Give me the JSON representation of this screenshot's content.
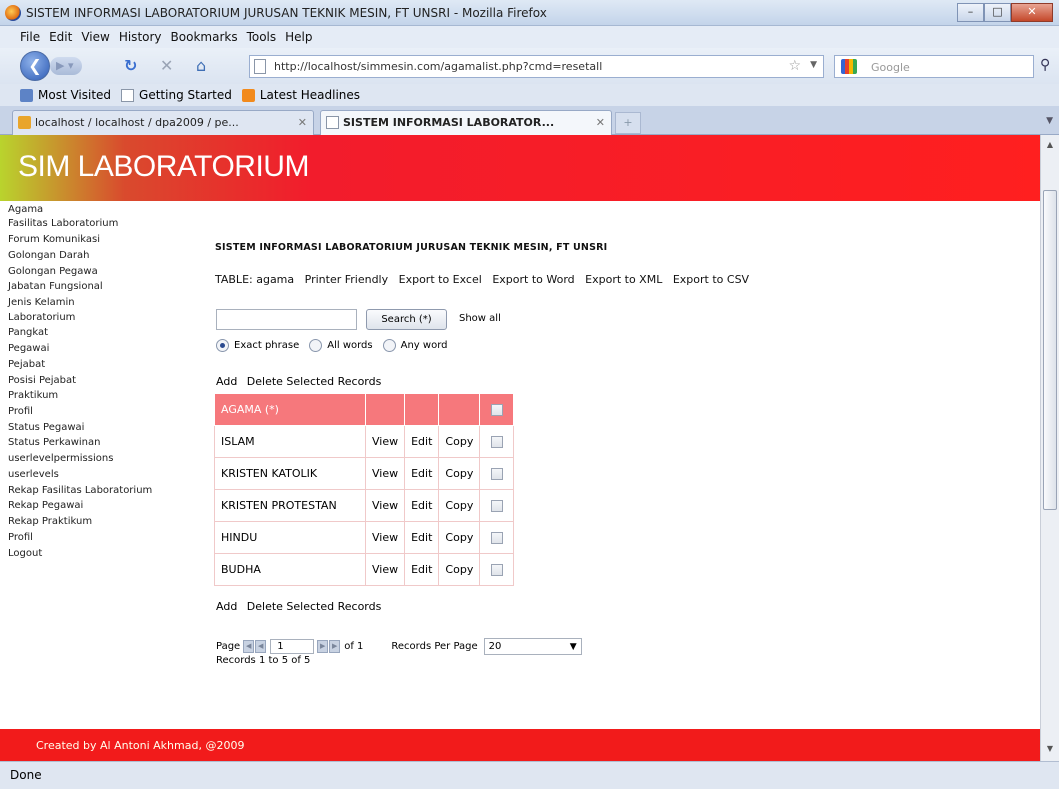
{
  "window": {
    "title": "SISTEM INFORMASI LABORATORIUM JURUSAN TEKNIK MESIN, FT UNSRI - Mozilla Firefox",
    "buttons": [
      "–",
      "□",
      "✕"
    ]
  },
  "menu": [
    "File",
    "Edit",
    "View",
    "History",
    "Bookmarks",
    "Tools",
    "Help"
  ],
  "nav": {
    "url": "http://localhost/simmesin.com/agamalist.php?cmd=resetall",
    "search_engine": "Google"
  },
  "bookmarks": [
    "Most Visited",
    "Getting Started",
    "Latest Headlines"
  ],
  "tabs": [
    {
      "label": "localhost / localhost / dpa2009 / pe...",
      "active": false
    },
    {
      "label": "SISTEM INFORMASI LABORATOR...",
      "active": true
    }
  ],
  "site": {
    "title": "SIM LABORATORIUM",
    "footer": "Created by Al Antoni Akhmad, @2009"
  },
  "sidebar": [
    "Agama",
    "Fasilitas Laboratorium",
    "Forum Komunikasi",
    "Golongan Darah",
    "Golongan Pegawa",
    "Jabatan Fungsional",
    "Jenis Kelamin",
    "Laboratorium",
    "Pangkat",
    "Pegawai",
    "Pejabat",
    "Posisi Pejabat",
    "Praktikum",
    "Profil",
    "Status Pegawai",
    "Status Perkawinan",
    "userlevelpermissions",
    "userlevels",
    "Rekap Fasilitas Laboratorium",
    "Rekap Pegawai",
    "Rekap Praktikum",
    "Profil",
    "Logout"
  ],
  "main": {
    "heading": "SISTEM INFORMASI LABORATORIUM JURUSAN TEKNIK MESIN, FT UNSRI",
    "table_label": "TABLE: agama",
    "export_links": [
      "Printer Friendly",
      "Export to Excel",
      "Export to Word",
      "Export to XML",
      "Export to CSV"
    ],
    "search": {
      "value": "",
      "button": "Search (*)",
      "show_all": "Show all"
    },
    "search_modes": [
      {
        "label": "Exact phrase",
        "selected": true
      },
      {
        "label": "All words",
        "selected": false
      },
      {
        "label": "Any word",
        "selected": false
      }
    ],
    "actions": {
      "add": "Add",
      "delete": "Delete Selected Records"
    },
    "table": {
      "header": "AGAMA (*)",
      "row_actions": {
        "view": "View",
        "edit": "Edit",
        "copy": "Copy"
      },
      "rows": [
        "ISLAM",
        "KRISTEN KATOLIK",
        "KRISTEN PROTESTAN",
        "HINDU",
        "BUDHA"
      ]
    },
    "pager": {
      "page_label": "Page",
      "page": "1",
      "of_label": "of 1",
      "records_per_page_label": "Records Per Page",
      "records_per_page": "20",
      "records_info": "Records 1 to 5 of 5"
    }
  },
  "status": "Done",
  "colors": {
    "header_red": "#f21c2c",
    "table_header": "#f6787c"
  }
}
